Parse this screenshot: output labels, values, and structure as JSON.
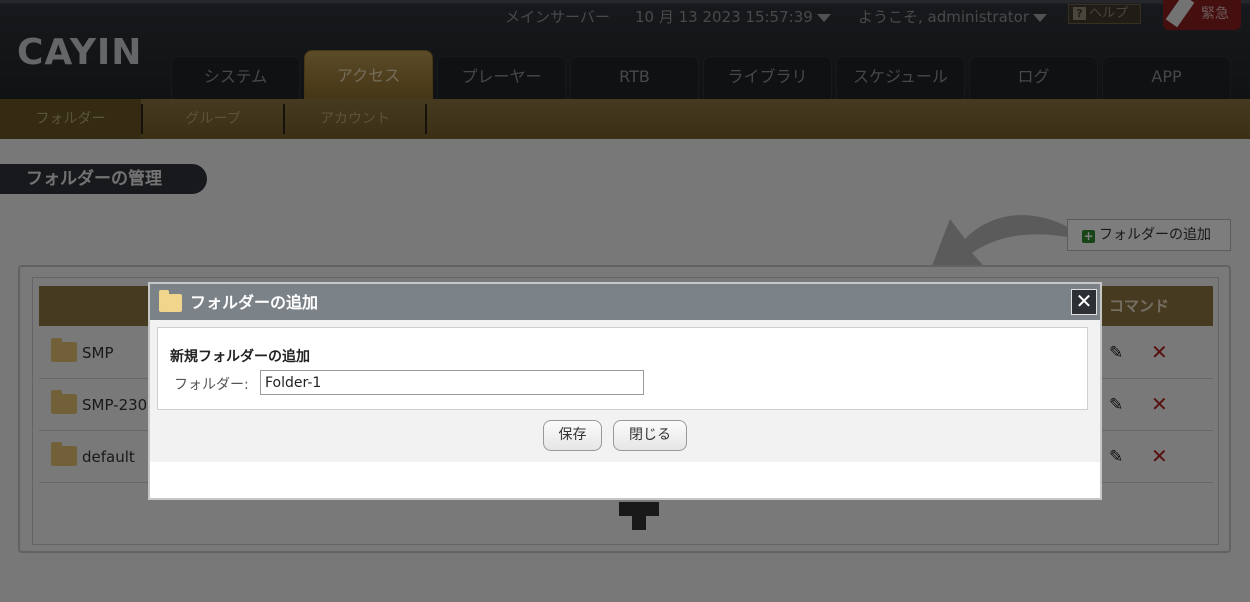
{
  "header": {
    "logo": "CAYIN",
    "server": "メインサーバー",
    "datetime": "10 月 13 2023 15:57:39",
    "welcome": "ようこそ, administrator",
    "help": "ヘルプ",
    "emergency": "緊急"
  },
  "tabs": [
    {
      "label": "システム"
    },
    {
      "label": "アクセス",
      "active": true
    },
    {
      "label": "プレーヤー"
    },
    {
      "label": "RTB"
    },
    {
      "label": "ライブラリ"
    },
    {
      "label": "スケジュール"
    },
    {
      "label": "ログ"
    },
    {
      "label": "APP"
    }
  ],
  "subnav": [
    {
      "label": "フォルダー",
      "active": true
    },
    {
      "label": "グループ"
    },
    {
      "label": "アカウント"
    }
  ],
  "page": {
    "title": "フォルダーの管理",
    "add_folder_label": "フォルダーの追加"
  },
  "table": {
    "command_header": "コマンド",
    "rows": [
      {
        "name": "SMP"
      },
      {
        "name": "SMP-230"
      },
      {
        "name": "default"
      }
    ]
  },
  "dialog": {
    "title": "フォルダーの追加",
    "heading": "新規フォルダーの追加",
    "folder_label": "フォルダー:",
    "folder_value": "Folder-1",
    "save_label": "保存",
    "close_label": "閉じる"
  },
  "colors": {
    "accent_gold": "#8d7642",
    "header_dark": "#202428",
    "emergency_red": "#8c1f1f"
  }
}
